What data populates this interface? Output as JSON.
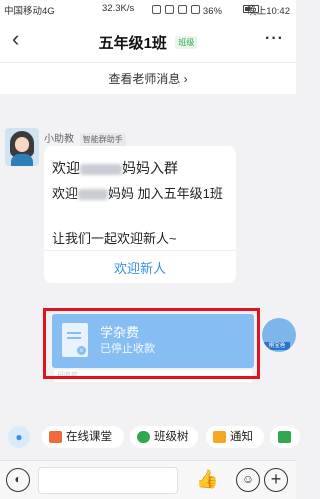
{
  "status_bar": {
    "carrier": "中国移动4G",
    "speed": "32.3K/s",
    "battery": "36%",
    "time": "晚上10:42"
  },
  "nav": {
    "back_glyph": "‹",
    "title": "五年级1班",
    "badge": "班级",
    "more_glyph": "···"
  },
  "teacher_msg": {
    "label": "查看老师消息 ›"
  },
  "message": {
    "sender": "小助教",
    "sender_tag": "智能群助手",
    "line1_prefix": "欢迎",
    "line1_suffix": "妈妈入群",
    "line2_prefix": "欢迎",
    "line2_suffix": "妈妈 加入五年级1班",
    "line3": "让我们一起欢迎新人~",
    "action": "欢迎新人"
  },
  "fee_card": {
    "title": "学杂费",
    "status": "已停止收款",
    "footer": "班收款"
  },
  "my_avatar_label": "桐宝爸",
  "toolbar": {
    "items": [
      {
        "label": "在线课堂",
        "color": "#f06a3c"
      },
      {
        "label": "班级树",
        "color": "#2fa84f"
      },
      {
        "label": "通知",
        "color": "#f5a623"
      },
      {
        "label": "",
        "color": "#2fa84f"
      }
    ]
  },
  "input_bar": {
    "mic_glyph": "◐",
    "thumb_glyph": "👍",
    "emoji_glyph": "☺",
    "plus_glyph": "+"
  }
}
